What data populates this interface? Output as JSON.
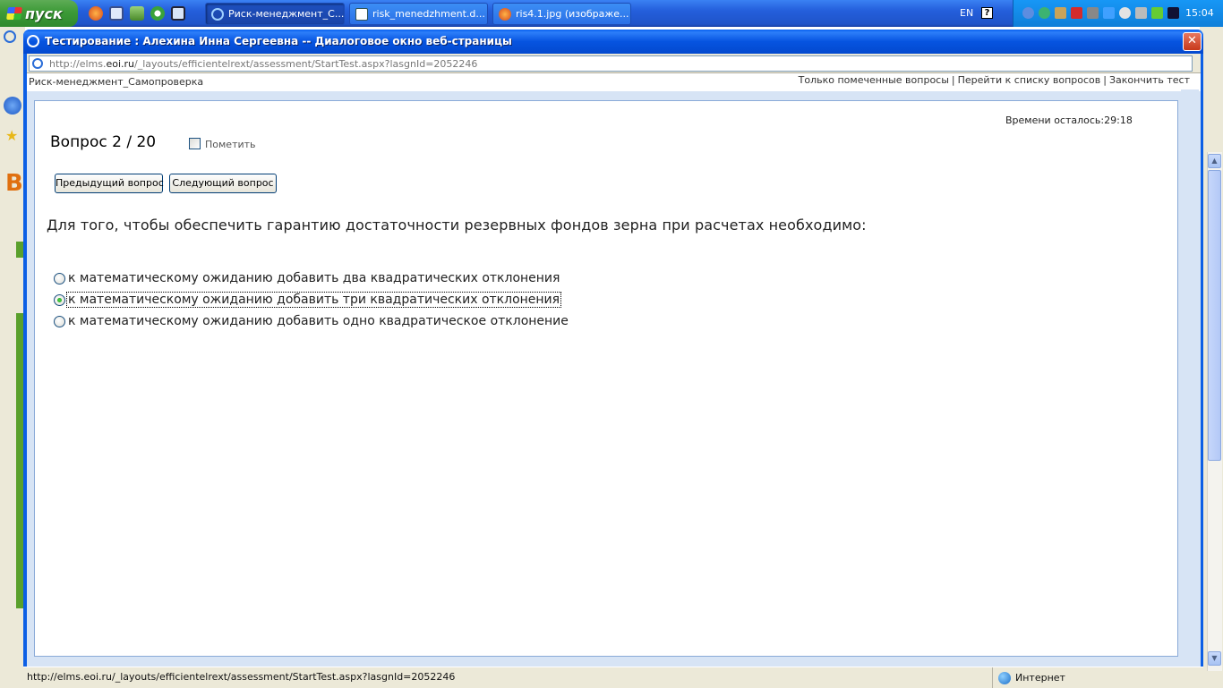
{
  "taskbar": {
    "start_label": "пуск",
    "tasks": [
      {
        "label": "Риск-менеджмент_С...",
        "active": true
      },
      {
        "label": "risk_menedzhment.d...",
        "active": false
      },
      {
        "label": "ris4.1.jpg (изображе...",
        "active": false
      }
    ],
    "language": "EN",
    "clock": "15:04"
  },
  "dialog": {
    "title": "Тестирование : Алехина Инна Сергеевна -- Диалоговое окно веб-страницы",
    "close_glyph": "✕",
    "address_prefix": "http://elms.",
    "address_domain": "eoi.ru",
    "address_suffix": "/_layouts/efficientelrext/assessment/StartTest.aspx?lasgnId=2052246"
  },
  "test": {
    "name": "Риск-менеджмент_Самопроверка",
    "links": {
      "marked_only": "Только помеченные вопросы",
      "sep": "|",
      "to_list": "Перейти к списку вопросов",
      "finish": "Закончить тест"
    },
    "timer": "Времени осталось:29:18",
    "question_number": "Вопрос 2 / 20",
    "mark_label": "Пометить",
    "prev_button": "Предыдущий вопрос",
    "next_button": "Следующий вопрос",
    "question_text": "Для того, чтобы обеспечить гарантию достаточности резервных фондов зерна при расчетах необходимо:",
    "options": [
      {
        "label": "к математическому ожиданию добавить два квадратических отклонения",
        "selected": false
      },
      {
        "label": "к математическому ожиданию добавить три квадратических отклонения",
        "selected": true
      },
      {
        "label": "к математическому ожиданию добавить одно квадратическое отклонение",
        "selected": false
      }
    ]
  },
  "statusbar": {
    "url": "http://elms.eoi.ru/_layouts/efficientelrext/assessment/StartTest.aspx?lasgnId=2052246",
    "zone": "Интернет"
  },
  "colors": {
    "title_bar": "#0654e0",
    "taskbar": "#245edb",
    "start_button": "#3c9a37",
    "close_button": "#c7381a"
  },
  "icons": [
    "windows-flag-icon",
    "firefox-icon",
    "save-icon",
    "utorrent-icon",
    "desktop-icon",
    "ie-icon",
    "document-icon",
    "globe-icon",
    "help-icon",
    "close-icon"
  ]
}
